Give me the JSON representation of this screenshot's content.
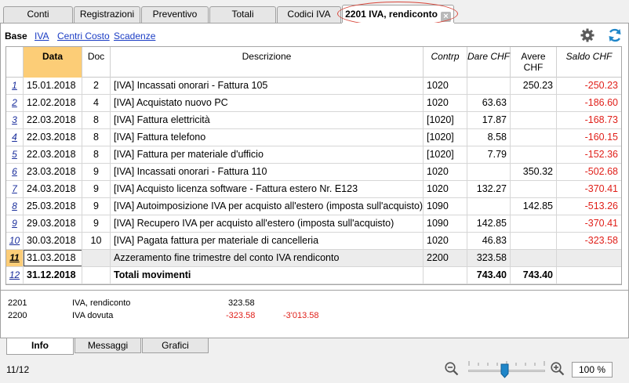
{
  "tabs": [
    {
      "label": "Conti"
    },
    {
      "label": "Registrazioni"
    },
    {
      "label": "Preventivo"
    },
    {
      "label": "Totali"
    },
    {
      "label": "Codici IVA"
    },
    {
      "label": "2201 IVA, rendiconto",
      "active": true
    }
  ],
  "subtabs": [
    "Base",
    "IVA",
    "Centri Costo",
    "Scadenze"
  ],
  "table": {
    "headers": [
      "Data",
      "Doc",
      "Descrizione",
      "Contrp",
      "Dare CHF",
      "Avere CHF",
      "Saldo CHF"
    ],
    "rows": [
      {
        "n": "1",
        "date": "15.01.2018",
        "doc": "2",
        "desc": "[IVA] Incassati onorari - Fattura 105",
        "contrp": "1020",
        "dare": "",
        "avere": "250.23",
        "saldo": "-250.23"
      },
      {
        "n": "2",
        "date": "12.02.2018",
        "doc": "4",
        "desc": "[IVA] Acquistato nuovo PC",
        "contrp": "1020",
        "dare": "63.63",
        "avere": "",
        "saldo": "-186.60"
      },
      {
        "n": "3",
        "date": "22.03.2018",
        "doc": "8",
        "desc": "[IVA] Fattura elettricità",
        "contrp": "[1020]",
        "dare": "17.87",
        "avere": "",
        "saldo": "-168.73"
      },
      {
        "n": "4",
        "date": "22.03.2018",
        "doc": "8",
        "desc": "[IVA] Fattura telefono",
        "contrp": "[1020]",
        "dare": "8.58",
        "avere": "",
        "saldo": "-160.15"
      },
      {
        "n": "5",
        "date": "22.03.2018",
        "doc": "8",
        "desc": "[IVA] Fattura per materiale d'ufficio",
        "contrp": "[1020]",
        "dare": "7.79",
        "avere": "",
        "saldo": "-152.36"
      },
      {
        "n": "6",
        "date": "23.03.2018",
        "doc": "9",
        "desc": "[IVA] Incassati onorari - Fattura 110",
        "contrp": "1020",
        "dare": "",
        "avere": "350.32",
        "saldo": "-502.68"
      },
      {
        "n": "7",
        "date": "24.03.2018",
        "doc": "9",
        "desc": "[IVA] Acquisto licenza software - Fattura estero Nr. E123",
        "contrp": "1020",
        "dare": "132.27",
        "avere": "",
        "saldo": "-370.41"
      },
      {
        "n": "8",
        "date": "25.03.2018",
        "doc": "9",
        "desc": "[IVA] Autoimposizione IVA per acquisto all'estero (imposta sull'acquisto)",
        "contrp": "1090",
        "dare": "",
        "avere": "142.85",
        "saldo": "-513.26"
      },
      {
        "n": "9",
        "date": "29.03.2018",
        "doc": "9",
        "desc": "[IVA] Recupero IVA per acquisto all'estero (imposta sull'acquisto)",
        "contrp": "1090",
        "dare": "142.85",
        "avere": "",
        "saldo": "-370.41"
      },
      {
        "n": "10",
        "date": "30.03.2018",
        "doc": "10",
        "desc": "[IVA] Pagata fattura per materiale di cancelleria",
        "contrp": "1020",
        "dare": "46.83",
        "avere": "",
        "saldo": "-323.58"
      },
      {
        "n": "11",
        "date": "31.03.2018",
        "doc": "",
        "desc": "Azzeramento fine trimestre del conto IVA rendiconto",
        "contrp": "2200",
        "dare": "323.58",
        "avere": "",
        "saldo": "",
        "selected": true
      },
      {
        "n": "12",
        "date": "31.12.2018",
        "doc": "",
        "desc": "Totali movimenti",
        "contrp": "",
        "dare": "743.40",
        "avere": "743.40",
        "saldo": "",
        "total": true
      }
    ]
  },
  "info": [
    {
      "account": "2201",
      "name": "IVA, rendiconto",
      "value1": "323.58",
      "value2": ""
    },
    {
      "account": "2200",
      "name": "IVA dovuta",
      "value1": "-323.58",
      "value2": "-3'013.58"
    }
  ],
  "bottom_tabs": [
    "Info",
    "Messaggi",
    "Grafici"
  ],
  "status": {
    "position": "11/12",
    "zoom_level": "100 %",
    "zoom_slider_fraction": 0.47
  },
  "colors": {
    "header_highlight": "#fccd77",
    "negative": "#e0201a",
    "link": "#1a3cc4",
    "annotation_ring": "#d8473b"
  }
}
